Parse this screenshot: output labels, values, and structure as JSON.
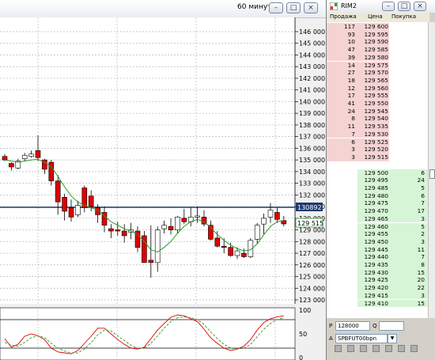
{
  "chart_window": {
    "title": "60 минут",
    "price_axis_ticks": [
      "146 000",
      "145 000",
      "144 000",
      "143 000",
      "142 000",
      "141 000",
      "140 000",
      "139 000",
      "138 000",
      "137 000",
      "136 000",
      "135 000",
      "134 000",
      "133 000",
      "132 000",
      "131 000",
      "130 000",
      "129 000",
      "128 000",
      "127 000",
      "126 000",
      "125 000",
      "124 000",
      "123 000"
    ],
    "osc_axis_ticks": [
      "100",
      "50",
      "0"
    ],
    "level_line_label": "130892",
    "last_price_label": "129 515",
    "colors": {
      "up": "#ffffff",
      "down": "#e00000",
      "ma": "#2a9a2a",
      "level": "#1f3a6e",
      "osc1": "#e00000",
      "osc2": "#2a9a2a"
    }
  },
  "chart_data": {
    "type": "candlestick",
    "ylim": [
      122500,
      146500
    ],
    "candles": [
      [
        135300,
        135500,
        134900,
        135000
      ],
      [
        134700,
        134800,
        134100,
        134400
      ],
      [
        134300,
        135100,
        134200,
        134900
      ],
      [
        135100,
        135600,
        134900,
        135400
      ],
      [
        135300,
        135800,
        135200,
        135500
      ],
      [
        135800,
        137100,
        134900,
        135200
      ],
      [
        135000,
        135100,
        133800,
        134200
      ],
      [
        134800,
        135000,
        132800,
        133200
      ],
      [
        133200,
        133700,
        130300,
        131400
      ],
      [
        131800,
        132100,
        129800,
        130600
      ],
      [
        130900,
        131600,
        129700,
        130100
      ],
      [
        130300,
        131500,
        130100,
        131100
      ],
      [
        132600,
        132800,
        130500,
        130900
      ],
      [
        131900,
        132400,
        130600,
        131000
      ],
      [
        130900,
        131200,
        129600,
        130300
      ],
      [
        130500,
        131000,
        128800,
        129400
      ],
      [
        129100,
        129500,
        128300,
        128900
      ],
      [
        129000,
        129700,
        128500,
        128900
      ],
      [
        128900,
        129500,
        127900,
        128500
      ],
      [
        128800,
        129600,
        128200,
        129000
      ],
      [
        128900,
        129300,
        127100,
        127500
      ],
      [
        128500,
        128900,
        126200,
        126200
      ],
      [
        126400,
        129400,
        124900,
        126200
      ],
      [
        126200,
        129300,
        125400,
        129000
      ],
      [
        129100,
        129800,
        128700,
        129400
      ],
      [
        129300,
        130000,
        128600,
        129000
      ],
      [
        129000,
        130200,
        128700,
        130100
      ],
      [
        130000,
        130800,
        129500,
        129700
      ],
      [
        129700,
        130900,
        129300,
        130100
      ],
      [
        130100,
        131000,
        129600,
        130200
      ],
      [
        130100,
        130700,
        129300,
        129500
      ],
      [
        129400,
        129800,
        128100,
        128200
      ],
      [
        128300,
        128900,
        127500,
        127600
      ],
      [
        127600,
        128300,
        127000,
        127500
      ],
      [
        127500,
        127900,
        126700,
        126800
      ],
      [
        126800,
        127500,
        126500,
        127200
      ],
      [
        127000,
        127400,
        126600,
        126700
      ],
      [
        126700,
        128300,
        126600,
        128100
      ],
      [
        128200,
        129600,
        127800,
        129400
      ],
      [
        129500,
        130400,
        128600,
        130000
      ],
      [
        130100,
        131300,
        129600,
        130700
      ],
      [
        130500,
        130900,
        129600,
        129900
      ],
      [
        129800,
        130200,
        129300,
        129515
      ]
    ],
    "moving_average": [
      135000,
      134900,
      134800,
      134900,
      135000,
      135050,
      134800,
      134400,
      133600,
      132700,
      131900,
      131400,
      131100,
      130900,
      130700,
      130200,
      129700,
      129400,
      129100,
      128900,
      128600,
      128000,
      127300,
      127100,
      127500,
      128000,
      128700,
      129300,
      129700,
      129900,
      129700,
      129200,
      128600,
      128100,
      127700,
      127400,
      127200,
      127300,
      127800,
      128600,
      129300,
      129700,
      129800
    ],
    "oscillator": {
      "ylim": [
        0,
        100
      ],
      "line1": [
        40,
        22,
        28,
        45,
        50,
        46,
        38,
        20,
        12,
        10,
        8,
        15,
        30,
        45,
        62,
        62,
        50,
        38,
        28,
        20,
        18,
        22,
        40,
        58,
        72,
        85,
        90,
        88,
        82,
        76,
        60,
        42,
        30,
        20,
        15,
        18,
        24,
        38,
        58,
        74,
        82,
        86,
        88
      ],
      "line2": [
        32,
        26,
        24,
        32,
        42,
        46,
        42,
        30,
        20,
        14,
        10,
        10,
        18,
        32,
        48,
        58,
        56,
        46,
        36,
        26,
        20,
        20,
        30,
        46,
        62,
        76,
        84,
        86,
        84,
        80,
        70,
        54,
        40,
        28,
        20,
        18,
        20,
        28,
        44,
        60,
        72,
        80,
        84
      ],
      "levels": [
        20,
        80
      ]
    }
  },
  "order_book": {
    "title": "RIM2",
    "headers": {
      "sell": "Продажа",
      "price": "Цена",
      "buy": "Покупка"
    },
    "asks": [
      {
        "qty": "117",
        "price": "129 600"
      },
      {
        "qty": "93",
        "price": "129 595"
      },
      {
        "qty": "10",
        "price": "129 590"
      },
      {
        "qty": "47",
        "price": "129 585"
      },
      {
        "qty": "39",
        "price": "129 580"
      },
      {
        "qty": "14",
        "price": "129 575"
      },
      {
        "qty": "27",
        "price": "129 570"
      },
      {
        "qty": "18",
        "price": "129 565"
      },
      {
        "qty": "12",
        "price": "129 560"
      },
      {
        "qty": "17",
        "price": "129 555"
      },
      {
        "qty": "41",
        "price": "129 550"
      },
      {
        "qty": "24",
        "price": "129 545"
      },
      {
        "qty": "8",
        "price": "129 540"
      },
      {
        "qty": "11",
        "price": "129 535"
      },
      {
        "qty": "7",
        "price": "129 530"
      },
      {
        "qty": "6",
        "price": "129 525"
      },
      {
        "qty": "3",
        "price": "129 520"
      },
      {
        "qty": "3",
        "price": "129 515"
      }
    ],
    "bids": [
      {
        "price": "129 500",
        "qty": "6"
      },
      {
        "price": "129 495",
        "qty": "24"
      },
      {
        "price": "129 485",
        "qty": "5"
      },
      {
        "price": "129 480",
        "qty": "6"
      },
      {
        "price": "129 475",
        "qty": "7"
      },
      {
        "price": "129 470",
        "qty": "17"
      },
      {
        "price": "129 465",
        "qty": "3"
      },
      {
        "price": "129 460",
        "qty": "5"
      },
      {
        "price": "129 455",
        "qty": "2"
      },
      {
        "price": "129 450",
        "qty": "3"
      },
      {
        "price": "129 445",
        "qty": "11"
      },
      {
        "price": "129 440",
        "qty": "7"
      },
      {
        "price": "129 435",
        "qty": "8"
      },
      {
        "price": "129 430",
        "qty": "15"
      },
      {
        "price": "129 425",
        "qty": "20"
      },
      {
        "price": "129 420",
        "qty": "22"
      },
      {
        "price": "129 415",
        "qty": "3"
      },
      {
        "price": "129 410",
        "qty": "15"
      }
    ],
    "bottom": {
      "p_label": "P",
      "p_value": "128000",
      "q_label": "Q",
      "q_value": "",
      "a_label": "A",
      "account": "SPBFUT00bpn"
    }
  }
}
